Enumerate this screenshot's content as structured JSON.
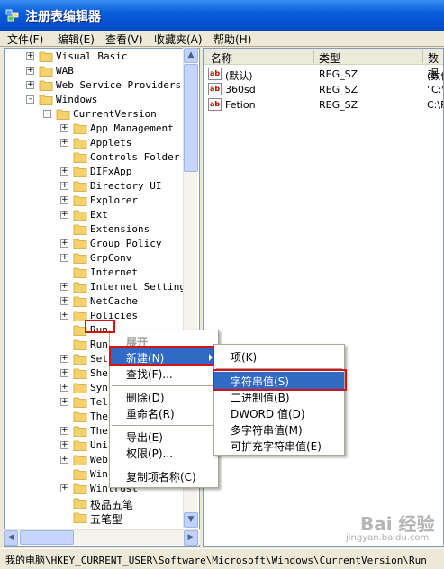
{
  "window": {
    "title": "注册表编辑器"
  },
  "menubar": {
    "items": [
      "文件(F)",
      "编辑(E)",
      "查看(V)",
      "收藏夹(A)",
      "帮助(H)"
    ]
  },
  "tree": {
    "items": [
      {
        "label": "Visual Basic",
        "expander": "+"
      },
      {
        "label": "WAB",
        "expander": "+"
      },
      {
        "label": "Web Service Providers",
        "expander": "+"
      },
      {
        "label": "Windows",
        "expander": "-"
      },
      {
        "label": "CurrentVersion",
        "expander": "-"
      },
      {
        "label": "App Management",
        "expander": "+"
      },
      {
        "label": "Applets",
        "expander": "+"
      },
      {
        "label": "Controls Folder",
        "expander": ""
      },
      {
        "label": "DIFxApp",
        "expander": "+"
      },
      {
        "label": "Directory UI",
        "expander": "+"
      },
      {
        "label": "Explorer",
        "expander": "+"
      },
      {
        "label": "Ext",
        "expander": "+"
      },
      {
        "label": "Extensions",
        "expander": ""
      },
      {
        "label": "Group Policy",
        "expander": "+"
      },
      {
        "label": "GrpConv",
        "expander": "+"
      },
      {
        "label": "Internet",
        "expander": ""
      },
      {
        "label": "Internet Settings",
        "expander": "+"
      },
      {
        "label": "NetCache",
        "expander": "+"
      },
      {
        "label": "Policies",
        "expander": "+"
      },
      {
        "label": "Run",
        "expander": ""
      },
      {
        "label": "Run",
        "expander": ""
      },
      {
        "label": "Set",
        "expander": "+"
      },
      {
        "label": "She",
        "expander": "+"
      },
      {
        "label": "Syn",
        "expander": "+"
      },
      {
        "label": "Tel",
        "expander": "+"
      },
      {
        "label": "The",
        "expander": ""
      },
      {
        "label": "The",
        "expander": "+"
      },
      {
        "label": "Uni",
        "expander": "+"
      },
      {
        "label": "Web",
        "expander": "+"
      },
      {
        "label": "Win",
        "expander": ""
      },
      {
        "label": "Wintrust",
        "expander": "+"
      },
      {
        "label": "极品五笔",
        "expander": ""
      },
      {
        "label": "五笔型",
        "expander": ""
      }
    ]
  },
  "list": {
    "headers": [
      "名称",
      "类型",
      "数据"
    ],
    "rows": [
      {
        "name": "(默认)",
        "type": "REG_SZ",
        "data": "(数值"
      },
      {
        "name": "360sd",
        "type": "REG_SZ",
        "data": "\"C:\\"
      },
      {
        "name": "Fetion",
        "type": "REG_SZ",
        "data": "C:\\P"
      }
    ]
  },
  "context_menu": {
    "items": [
      "展开",
      "新建(N)",
      "查找(F)...",
      "删除(D)",
      "重命名(R)",
      "导出(E)",
      "权限(P)...",
      "复制项名称(C)"
    ]
  },
  "submenu": {
    "items": [
      "项(K)",
      "字符串值(S)",
      "二进制值(B)",
      "DWORD 值(D)",
      "多字符串值(M)",
      "可扩充字符串值(E)"
    ]
  },
  "statusbar": {
    "path": "我的电脑\\HKEY_CURRENT_USER\\Software\\Microsoft\\Windows\\CurrentVersion\\Run"
  },
  "watermark": {
    "brand": "Bai 经验",
    "url": "jingyan.baidu.com"
  },
  "colors": {
    "highlight": "#316ac5",
    "annotation": "#d41414",
    "title_bar": "#0a5fdc"
  }
}
